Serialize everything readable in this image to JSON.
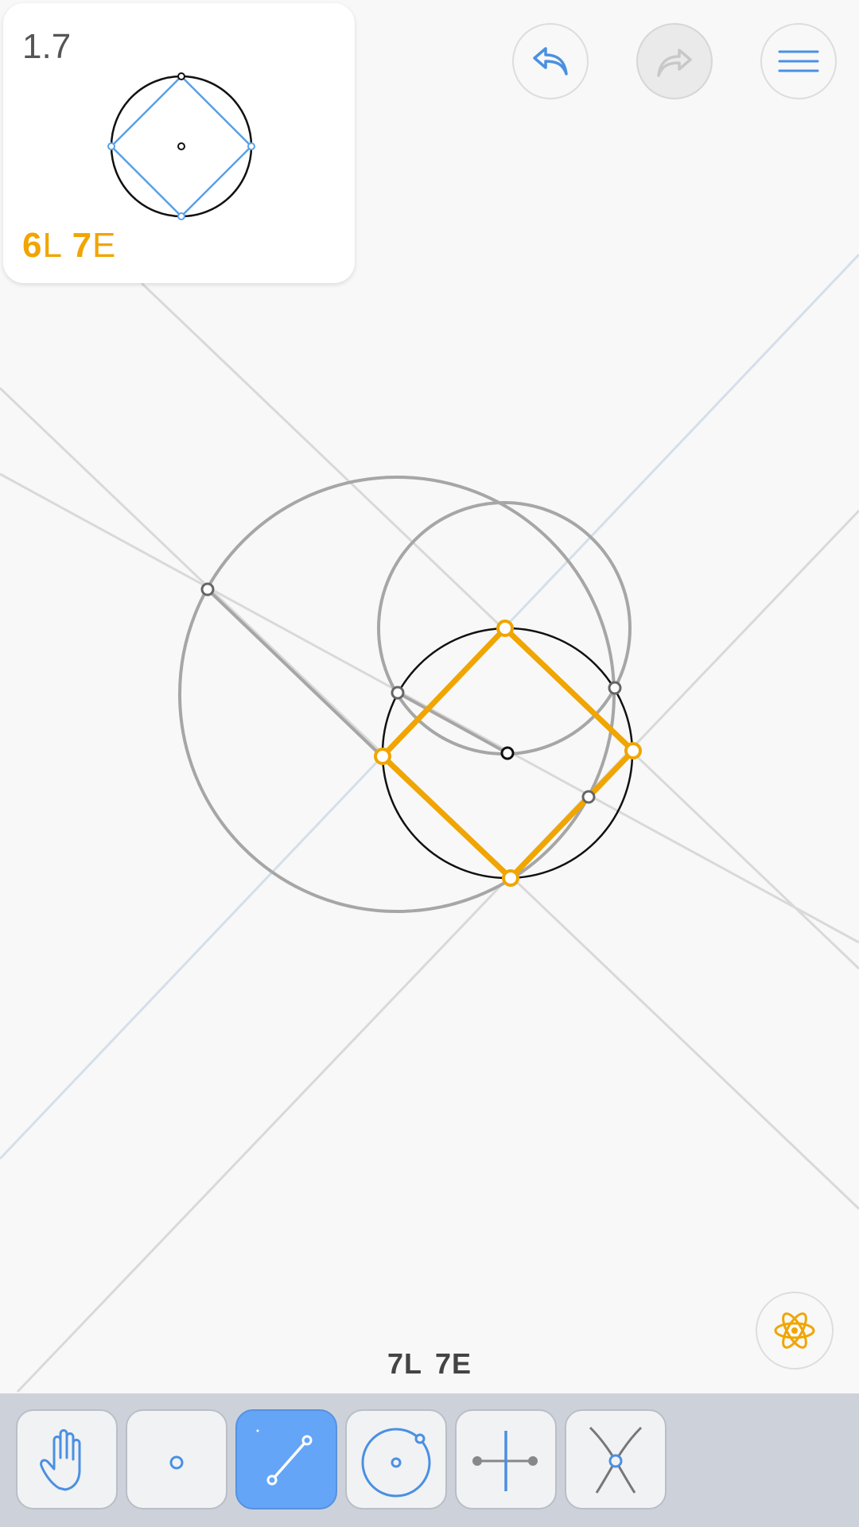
{
  "level": {
    "number": "1.7",
    "goal_lines_value": "6",
    "goal_lines_unit": "L",
    "goal_euclid_value": "7",
    "goal_euclid_unit": "E"
  },
  "moves": {
    "lines": "7L",
    "euclid": "7E"
  },
  "buttons": {
    "undo": "undo-icon",
    "redo": "redo-icon",
    "menu": "menu-icon",
    "hint": "atom-icon"
  },
  "tools": [
    {
      "name": "move",
      "icon": "hand-icon",
      "active": false
    },
    {
      "name": "point",
      "icon": "point-icon",
      "active": false
    },
    {
      "name": "line",
      "icon": "line-icon",
      "active": true
    },
    {
      "name": "circle",
      "icon": "circle-icon",
      "active": false
    },
    {
      "name": "perpendicular-bisector",
      "icon": "perpendicular-bisector-icon",
      "active": false
    },
    {
      "name": "intersect",
      "icon": "intersect-icon",
      "active": false
    }
  ],
  "colors": {
    "accent": "#f0a500",
    "tool_blue": "#4a90e2",
    "active_tool": "#64a5f8",
    "toolbar": "#cdd2da"
  }
}
